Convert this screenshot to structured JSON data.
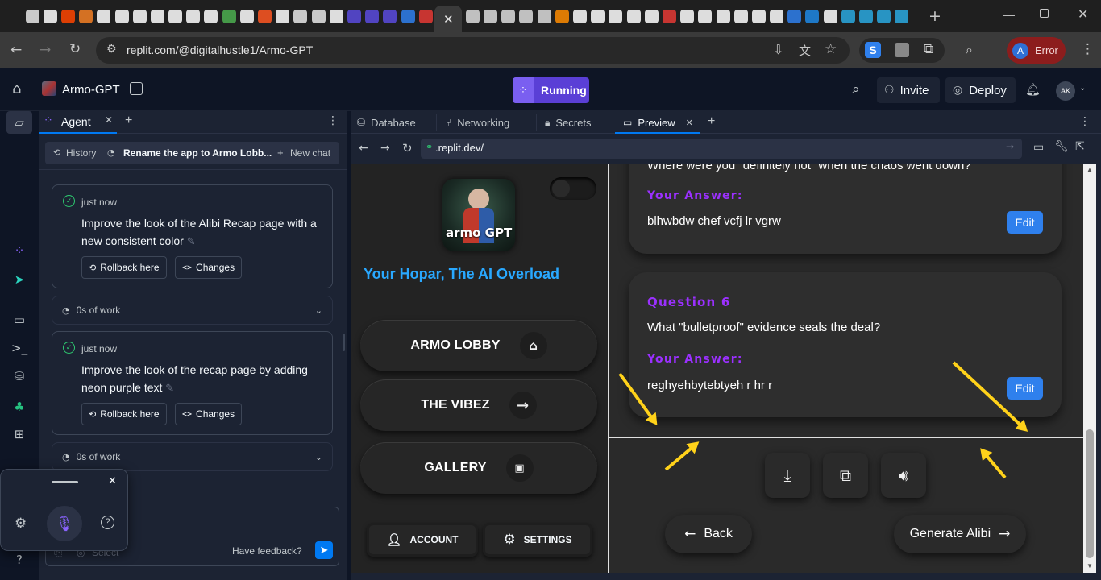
{
  "browser": {
    "url": "replit.com/@digitalhustle1/Armo-GPT",
    "profile_initial": "A",
    "profile_status": "Error",
    "tab_favicons": [
      "#e8e8e8",
      "#ffffff",
      "#ff4500",
      "#f48024",
      "#ffffff",
      "#ffffff",
      "#ffffff",
      "#ffffff",
      "#ffffff",
      "#ffffff",
      "#ffffff",
      "#4caf50",
      "#ffffff",
      "#ff5722",
      "#ffffff",
      "#e8e8e8",
      "#e8e8e8",
      "#ffffff",
      "#5b4bde",
      "#5b4bde",
      "#5b4bde",
      "#2f80ed",
      "#e53935"
    ],
    "tab_favicons_right": [
      "#dddddd",
      "#dddddd",
      "#dddddd",
      "#dddddd",
      "#dddddd",
      "#ff8c00",
      "#ffffff",
      "#ffffff",
      "#ffffff",
      "#ffffff",
      "#ffffff",
      "#e53935",
      "#ffffff",
      "#ffffff",
      "#ffffff",
      "#ffffff",
      "#ffffff",
      "#ffffff",
      "#2f80ed",
      "#1e88e5",
      "#ffffff",
      "#2aa9e0",
      "#2aa9e0",
      "#2aa9e0",
      "#2aa9e0"
    ]
  },
  "header": {
    "project_name": "Armo-GPT",
    "run_status": "Running",
    "invite_label": "Invite",
    "deploy_label": "Deploy",
    "avatar_initials": "AK"
  },
  "agent": {
    "tab_label": "Agent",
    "history_label": "History",
    "chat_title": "Rename the app to Armo Lobb...",
    "new_chat_label": "New chat",
    "entries": [
      {
        "time": "just now",
        "message": "Improve the look of the Alibi Recap page with a new consistent color",
        "rollback": "Rollback here",
        "changes": "Changes",
        "work": "0s of work"
      },
      {
        "time": "just now",
        "message": "Improve the look of the recap page by adding neon purple text",
        "rollback": "Rollback here",
        "changes": "Changes",
        "work": "0s of work"
      }
    ],
    "input_select_label": "Select",
    "feedback_label": "Have feedback?"
  },
  "workspace": {
    "tabs": [
      "Database",
      "Networking",
      "Secrets",
      "Preview"
    ],
    "preview_url": ".replit.dev/"
  },
  "app": {
    "logo_text": "armo GPT",
    "tagline": "Your Hopar, The AI Overload",
    "nav": [
      {
        "label": "ARMO LOBBY",
        "icon": "home-icon",
        "glyph": "⌂"
      },
      {
        "label": "THE VIBEZ",
        "icon": "arrow-right-icon",
        "glyph": "→"
      },
      {
        "label": "GALLERY",
        "icon": "image-icon",
        "glyph": "▣"
      }
    ],
    "account_label": "ACCOUNT",
    "settings_label": "SETTINGS",
    "partial_question": "Where were you \"definitely not\" when the chaos went down?",
    "questions": [
      {
        "answer_label": "Your Answer:",
        "answer": "blhwbdw chef vcfj lr vgrw",
        "edit": "Edit"
      },
      {
        "label": "Question 6",
        "text": "What \"bulletproof\" evidence seals the deal?",
        "answer_label": "Your Answer:",
        "answer": "reghyehbytebtyeh r hr r",
        "edit": "Edit"
      }
    ],
    "back_label": "Back",
    "generate_label": "Generate Alibi"
  },
  "colors": {
    "accent_purple": "#9b30ff",
    "edit_blue": "#2f80ed",
    "tagline_blue": "#29a8ff",
    "running_purple": "#5a3fd6",
    "annotation_yellow": "#ffd21a"
  }
}
